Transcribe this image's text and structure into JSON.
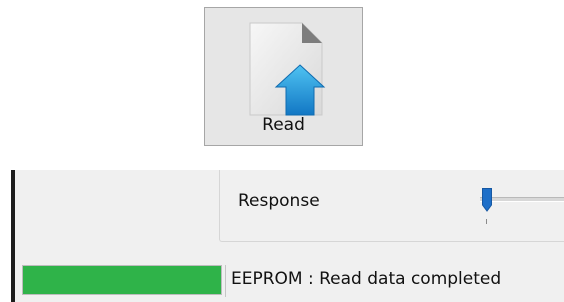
{
  "toolbar": {
    "read_button": {
      "label": "Read",
      "icon": "document-upload-icon"
    }
  },
  "settings_panel": {
    "response": {
      "label": "Response",
      "slider_value_fraction": 0
    }
  },
  "status_bar": {
    "progress_percent": 100,
    "message": "EEPROM : Read data completed"
  },
  "colors": {
    "progress_fill": "#2fb349",
    "slider_thumb": "#1e6fc8",
    "upload_arrow": "#1a8fd6",
    "button_background": "#e6e6e6"
  }
}
